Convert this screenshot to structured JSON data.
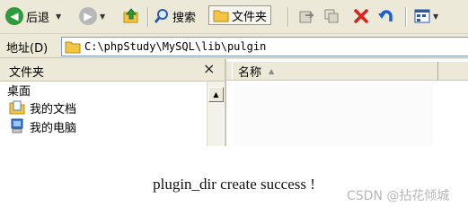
{
  "toolbar": {
    "back_label": "后退",
    "search_label": "搜索",
    "folders_label": "文件夹"
  },
  "address": {
    "label": "地址(D)",
    "path": "C:\\phpStudy\\MySQL\\lib\\pulgin"
  },
  "folder_pane": {
    "title": "文件夹",
    "close": "×",
    "items": [
      "桌面",
      "我的文档",
      "我的电脑"
    ]
  },
  "file_list": {
    "column_name": "名称"
  },
  "message": "plugin_dir create success !",
  "watermark": "CSDN @拈花倾城",
  "colors": {
    "back_green": "#2f9a3b",
    "forward_gray": "#9a9a9a",
    "delete_red": "#e0201b",
    "undo_blue": "#1c5fd4",
    "folder_yellow": "#f4c542"
  }
}
